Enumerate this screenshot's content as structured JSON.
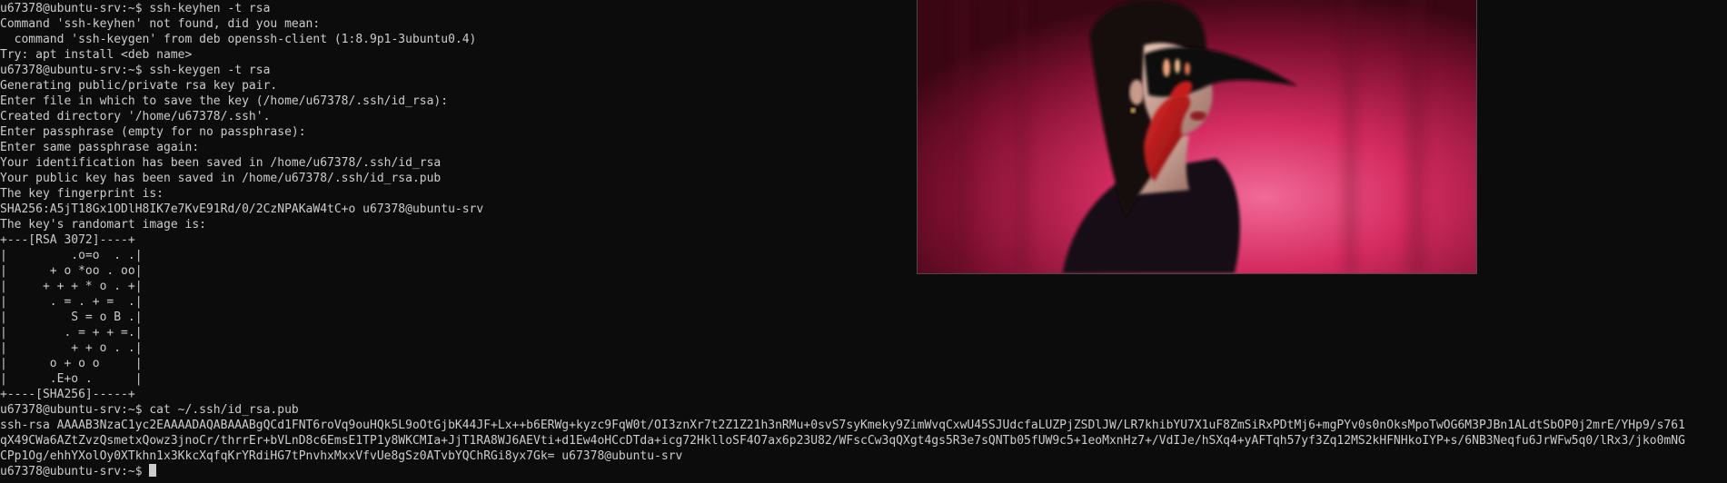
{
  "terminal": {
    "lines": [
      "u67378@ubuntu-srv:~$ ssh-keyhen -t rsa",
      "Command 'ssh-keyhen' not found, did you mean:",
      "  command 'ssh-keygen' from deb openssh-client (1:8.9p1-3ubuntu0.4)",
      "Try: apt install <deb name>",
      "u67378@ubuntu-srv:~$ ssh-keygen -t rsa",
      "Generating public/private rsa key pair.",
      "Enter file in which to save the key (/home/u67378/.ssh/id_rsa):",
      "Created directory '/home/u67378/.ssh'.",
      "Enter passphrase (empty for no passphrase):",
      "Enter same passphrase again:",
      "Your identification has been saved in /home/u67378/.ssh/id_rsa",
      "Your public key has been saved in /home/u67378/.ssh/id_rsa.pub",
      "The key fingerprint is:",
      "SHA256:A5jT18Gx1ODlH8IK7e7KvE91Rd/0/2CzNPAKaW4tC+o u67378@ubuntu-srv",
      "The key's randomart image is:",
      "+---[RSA 3072]----+",
      "|         .o=o  . .|",
      "|      + o *oo . oo|",
      "|     + + + * o . +|",
      "|      . = . + =  .|",
      "|         S = o B .|",
      "|        . = + + =.|",
      "|         + + o . .|",
      "|      o + o o     |",
      "|      .E+o .      |",
      "+----[SHA256]-----+",
      "u67378@ubuntu-srv:~$ cat ~/.ssh/id_rsa.pub",
      "ssh-rsa AAAAB3NzaC1yc2EAAAADAQABAAABgQCd1FNT6roVq9ouHQk5L9oOtGjbK44JF+Lx++b6ERWg+kyzc9FqW0t/OI3znXr7t2Z1Z21h3nRMu+0svS7syKmeky9ZimWvqCxwU45SJUdcfaLUZPjZSDlJW/LR7khibYU7X1uF8ZmSiRxPDtMj6+mgPYv0s0nOksMpoTwOG6M3PJBn1ALdtSbOP0j2mrE/YHp9/s761",
      "qX49CWa6AZtZvzQsmetxQowz3jnoCr/thrrEr+bVLnD8c6EmsE1TP1y8WKCMIa+JjT1RA8WJ6AEVti+d1Ew4oHCcDTda+icg72HklloSF4O7ax6p23U82/WFscCw3qQXgt4gs5R3e7sQNTb05fUW9c5+1eoMxnHz7+/VdIJe/hSXq4+yAFTqh57yf3Zq12MS2kHFNHkoIYP+s/6NB3Neqfu6JrWFw5q0/lRx3/jko0mNG",
      "CPp1Og/ehhYXolOy0XTkhn1x3KkcXqfqKrYRdiHG7tPnvhxMxxVfvUe8gSz0ATvbYQChRGi8yx7Gk= u67378@ubuntu-srv"
    ],
    "prompt": "u67378@ubuntu-srv:~$ "
  },
  "overlay_image": {
    "description_icon": "image-thumbnail",
    "palette": {
      "background_deep": "#7a0f2e",
      "background_glow": "#e23a6c",
      "skin": "#d9b3a6",
      "hair": "#141014",
      "glove": "#c21818",
      "border": "#4a4a4a"
    }
  },
  "colors": {
    "terminal_bg": "#0c0c0c",
    "terminal_fg": "#cccccc"
  }
}
